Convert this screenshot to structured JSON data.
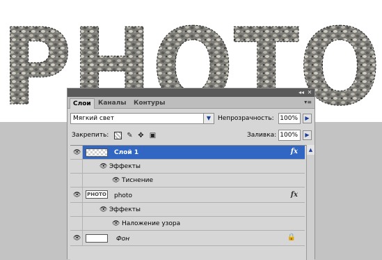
{
  "canvas": {
    "art_text": "PHOTO"
  },
  "panel": {
    "collapse_glyph": "◂◂",
    "close_glyph": "✕",
    "tabs": [
      {
        "label": "Слои"
      },
      {
        "label": "Каналы"
      },
      {
        "label": "Контуры"
      }
    ],
    "menu_glyph": "▾≡",
    "blend_mode": "Мягкий свет",
    "opacity_label": "Непрозрачность:",
    "opacity_value": "100%",
    "lock_label": "Закрепить:",
    "fill_label": "Заливка:",
    "fill_value": "100%",
    "layers": [
      {
        "name": "Слой 1",
        "fx": "fx",
        "effects_label": "Эффекты",
        "effect": "Тиснение"
      },
      {
        "name": "photo",
        "thumb_text": "PHOTO",
        "fx": "fx",
        "effects_label": "Эффекты",
        "effect": "Наложение узора"
      },
      {
        "name": "Фон"
      }
    ]
  },
  "icons": {
    "eye": "eye-icon",
    "lock": "lock-icon",
    "move": "move-icon",
    "brush": "brush-icon"
  },
  "colors": {
    "selection": "#3266c3",
    "panel_bg": "#d6d6d6",
    "canvas_grey": "#c3c3c3"
  }
}
